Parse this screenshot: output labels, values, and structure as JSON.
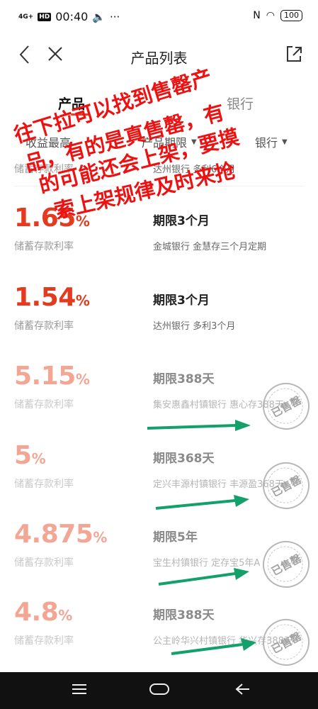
{
  "status": {
    "signal": "4G+",
    "hd": "HD",
    "time": "00:40",
    "nfc": "N",
    "battery": "100"
  },
  "nav": {
    "title": "产品列表",
    "back_icon": "chevron-left-icon",
    "close_icon": "close-icon",
    "share_icon": "share-icon"
  },
  "tabs": {
    "active": "产品",
    "other": "银行"
  },
  "filters": {
    "f1": "收益最高",
    "f2": "产品期限",
    "f3": "银行"
  },
  "overlay": {
    "line1": "往下拉可以找到售罄产",
    "line2": "品，有的是真售罄，有",
    "line3": "的可能还会上架，要摸",
    "line4": "索上架规律及时来抢"
  },
  "rows": [
    {
      "rate": "1.65",
      "label": "储蓄存款利率",
      "period": "期限3个月",
      "bank": "金城银行 金慧存三个月定期",
      "sold": false
    },
    {
      "rate": "1.54",
      "label": "储蓄存款利率",
      "period": "期限3个月",
      "bank": "达州银行 多利3个月",
      "sold": false
    },
    {
      "rate": "5.15",
      "label": "储蓄存款利率",
      "period": "期限388天",
      "bank": "集安惠鑫村镇银行 惠心存388天",
      "sold": true
    },
    {
      "rate": "5",
      "label": "储蓄存款利率",
      "period": "期限368天",
      "bank": "定兴丰源村镇银行 丰源盈368天",
      "sold": true
    },
    {
      "rate": "4.875",
      "label": "储蓄存款利率",
      "period": "期限5年",
      "bank": "宝生村镇银行 定存宝5年A",
      "sold": true
    },
    {
      "rate": "4.8",
      "label": "储蓄存款利率",
      "period": "期限388天",
      "bank": "公主岭华兴村镇银行 华兴存388天",
      "sold": true
    }
  ],
  "top_partial": {
    "label": "储蓄存款利率",
    "bank": "达州银行 多利6个月"
  },
  "pct": "%",
  "sold_stamp": "已售罄",
  "arrow_color": "#14a06a",
  "accent_color": "#e23b20"
}
